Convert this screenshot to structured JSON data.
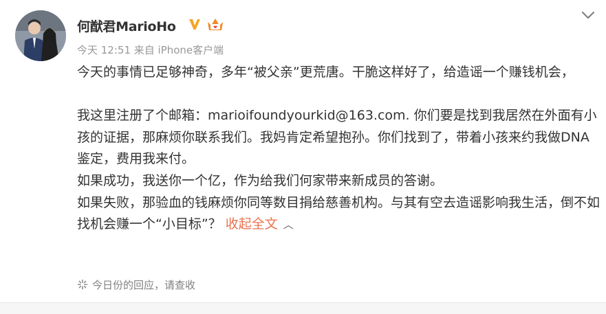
{
  "post": {
    "username": "何猷君MarioHo",
    "verified_icon": "verified-v-icon",
    "vip_icon": "vip-crown-icon",
    "timestamp": "今天 12:51 来自 iPhone客户端",
    "paragraphs": [
      "今天的事情已足够神奇，多年“被父亲”更荒唐。干脆这样好了，给造谣一个赚钱机会，",
      "",
      "我这里注册了个邮箱：marioifoundyourkid@163.com. 你们要是找到我居然在外面有小孩的证据，那麻烦你联系我们。我妈肯定希望抱孙。你们找到了，带着小孩来约我做DNA鉴定，费用我来付。",
      "如果成功，我送你一个亿，作为给我们何家带来新成员的答谢。"
    ],
    "last_paragraph": "如果失败，那验血的钱麻烦你同等数目捐给慈善机构。与其有空去造谣影响我生活，倒不如找机会赚一个“小目标”？",
    "collapse_label": "收起全文",
    "collapse_icon": "chevron-up-icon",
    "reply_notice": "今日份的回应，请查收",
    "reply_icon": "sparkle-icon",
    "menu_icon": "chevron-down-icon"
  },
  "colors": {
    "text": "#333333",
    "meta": "#999999",
    "accent": "#eb7350",
    "verified": "#f5a623"
  }
}
